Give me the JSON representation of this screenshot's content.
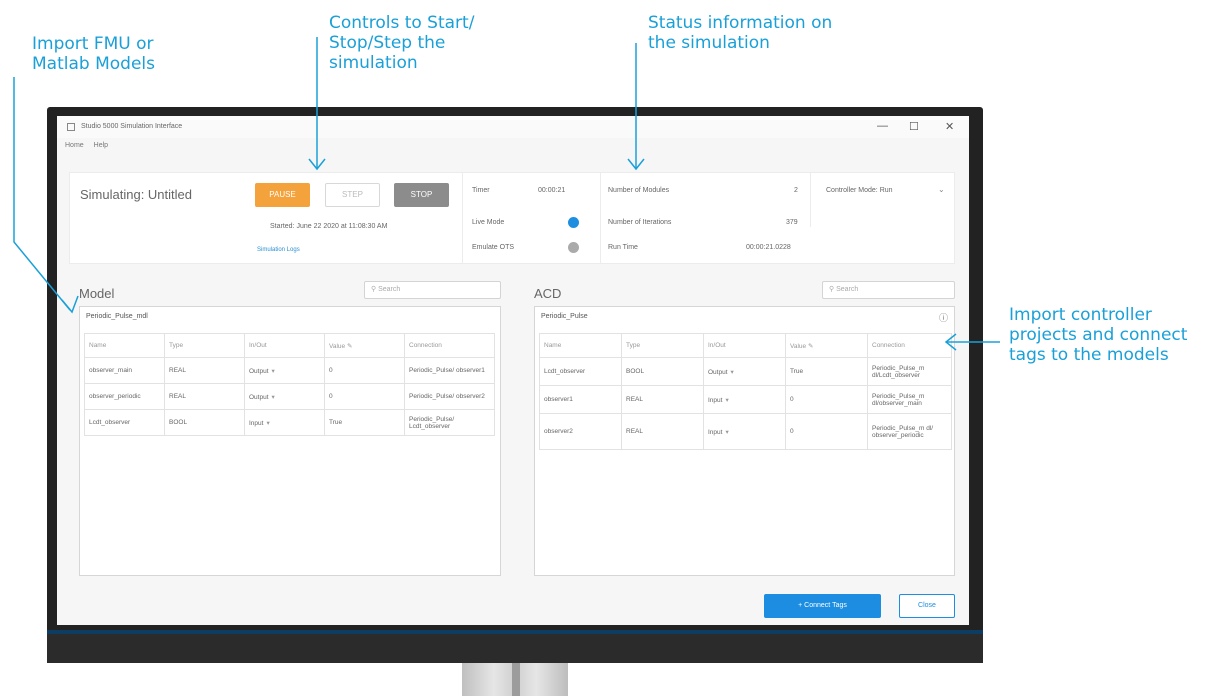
{
  "callouts": {
    "import_models": [
      "Import FMU or",
      "Matlab Models"
    ],
    "controls": [
      "Controls to Start/",
      "Stop/Step the",
      "simulation"
    ],
    "status": [
      "Status information on",
      "the simulation"
    ],
    "import_controller": [
      "Import controller",
      "projects and connect",
      "tags to the models"
    ]
  },
  "accent_color": "#1aa0d8",
  "window": {
    "title": "Studio 5000 Simulation Interface",
    "controls": {
      "minimize": "—",
      "maximize": "☐",
      "close": "✕"
    }
  },
  "menu": {
    "items": [
      "Home",
      "Help"
    ]
  },
  "status": {
    "title": "Simulating: Untitled",
    "start_label": "PAUSE",
    "step_label": "STEP",
    "stop_label": "STOP",
    "started_text": "Started: June 22 2020 at 11:08:30 AM",
    "link_text": "Simulation Logs",
    "timer_label": "Timer",
    "timer_value": "00:00:21",
    "live_mode_label": "Live Mode",
    "simulate_label": "Emulate OTS",
    "modules_label": "Number of Modules",
    "modules_value": "2",
    "iterations_label": "Number of Iterations",
    "iterations_value": "379",
    "runtime_label": "Run Time",
    "runtime_value": "00:00:21.0228",
    "controller_mode": "Controller Mode: Run"
  },
  "model": {
    "heading": "Model",
    "search_placeholder": "Search",
    "name": "Periodic_Pulse_mdl",
    "columns": [
      "Name",
      "Type",
      "In/Out",
      "Value",
      "Connection"
    ],
    "rows": [
      {
        "name": "observer_main",
        "type": "REAL",
        "io": "Output",
        "value": "0",
        "connection": "Periodic_Pulse/ observer1"
      },
      {
        "name": "observer_periodic",
        "type": "REAL",
        "io": "Output",
        "value": "0",
        "connection": "Periodic_Pulse/ observer2"
      },
      {
        "name": "Lcdt_observer",
        "type": "BOOL",
        "io": "Input",
        "value": "True",
        "connection": "Periodic_Pulse/ Lcdt_observer"
      }
    ]
  },
  "acd": {
    "heading": "ACD",
    "search_placeholder": "Search",
    "name": "Periodic_Pulse",
    "columns": [
      "Name",
      "Type",
      "In/Out",
      "Value",
      "Connection"
    ],
    "rows": [
      {
        "name": "Lcdt_observer",
        "type": "BOOL",
        "io": "Output",
        "value": "True",
        "connection": "Periodic_Pulse_m dl/Lcdt_observer"
      },
      {
        "name": "observer1",
        "type": "REAL",
        "io": "Input",
        "value": "0",
        "connection": "Periodic_Pulse_m dl/observer_main"
      },
      {
        "name": "observer2",
        "type": "REAL",
        "io": "Input",
        "value": "0",
        "connection": "Periodic_Pulse_m dl/ observer_periodic"
      }
    ]
  },
  "footer": {
    "connect_label": "+ Connect Tags",
    "close_label": "Close"
  }
}
